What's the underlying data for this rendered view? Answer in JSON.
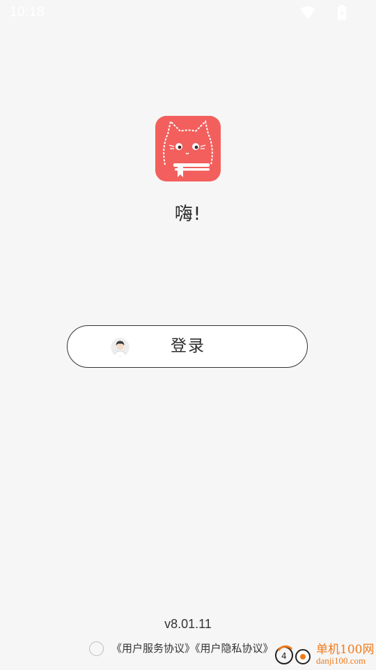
{
  "status_bar": {
    "time": "10:18",
    "icons": [
      "wifi-icon",
      "battery-icon"
    ]
  },
  "app": {
    "logo_icon": "cat-book-logo",
    "brand_color": "#f25f5c",
    "greeting": "嗨!"
  },
  "login": {
    "avatar_icon": "user-avatar-icon",
    "label": "登录"
  },
  "footer": {
    "version": "v8.01.11",
    "terms_link": "《用户服务协议》",
    "privacy_link": "《用户隐私协议》",
    "agree_checked": false
  },
  "watermark": {
    "title": "单机100网",
    "url": "danji100.com",
    "color": "#f07a1a"
  }
}
